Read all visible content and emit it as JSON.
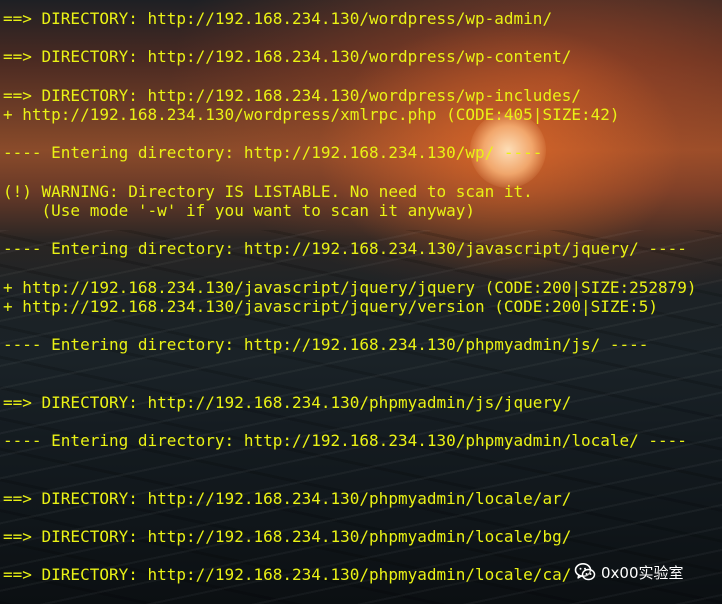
{
  "terminal": {
    "lines": [
      "==> DIRECTORY: http://192.168.234.130/wordpress/wp-admin/",
      "",
      "==> DIRECTORY: http://192.168.234.130/wordpress/wp-content/",
      "",
      "==> DIRECTORY: http://192.168.234.130/wordpress/wp-includes/",
      "+ http://192.168.234.130/wordpress/xmlrpc.php (CODE:405|SIZE:42)",
      "",
      "---- Entering directory: http://192.168.234.130/wp/ ----",
      "",
      "(!) WARNING: Directory IS LISTABLE. No need to scan it.",
      "    (Use mode '-w' if you want to scan it anyway)",
      "",
      "---- Entering directory: http://192.168.234.130/javascript/jquery/ ----",
      "",
      "+ http://192.168.234.130/javascript/jquery/jquery (CODE:200|SIZE:252879)",
      "+ http://192.168.234.130/javascript/jquery/version (CODE:200|SIZE:5)",
      "",
      "---- Entering directory: http://192.168.234.130/phpmyadmin/js/ ----",
      "",
      "",
      "==> DIRECTORY: http://192.168.234.130/phpmyadmin/js/jquery/",
      "",
      "---- Entering directory: http://192.168.234.130/phpmyadmin/locale/ ----",
      "",
      "",
      "==> DIRECTORY: http://192.168.234.130/phpmyadmin/locale/ar/",
      "",
      "==> DIRECTORY: http://192.168.234.130/phpmyadmin/locale/bg/",
      "",
      "==> DIRECTORY: http://192.168.234.130/phpmyadmin/locale/ca/"
    ],
    "text_color": "#eaf215"
  },
  "watermark": {
    "text": "0x00实验室",
    "icon": "wechat-icon",
    "color": "#ffffff"
  }
}
